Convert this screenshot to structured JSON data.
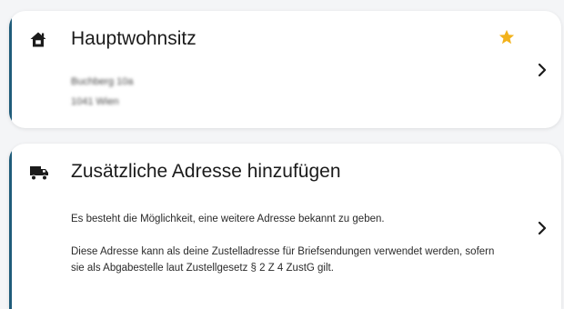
{
  "main_address": {
    "title": "Hauptwohnsitz",
    "icon": "home-icon",
    "favorite_icon": "star-icon",
    "favorite_color": "#f2b21b",
    "street_line": "Buchberg 10a",
    "city_line": "1041 Wien",
    "chevron_icon": "chevron-right-icon"
  },
  "add_address": {
    "title": "Zusätzliche Adresse hinzufügen",
    "icon": "truck-icon",
    "description_1": "Es besteht die Möglichkeit, eine weitere Adresse bekannt zu geben.",
    "description_2": "Diese Adresse kann als deine Zustelladresse für Briefsendungen verwendet werden, sofern sie als Abgabestelle laut Zustellgesetz § 2 Z 4 ZustG gilt.",
    "chevron_icon": "chevron-right-icon"
  },
  "colors": {
    "accent_border": "#1f5c7a",
    "star": "#f2b21b"
  }
}
